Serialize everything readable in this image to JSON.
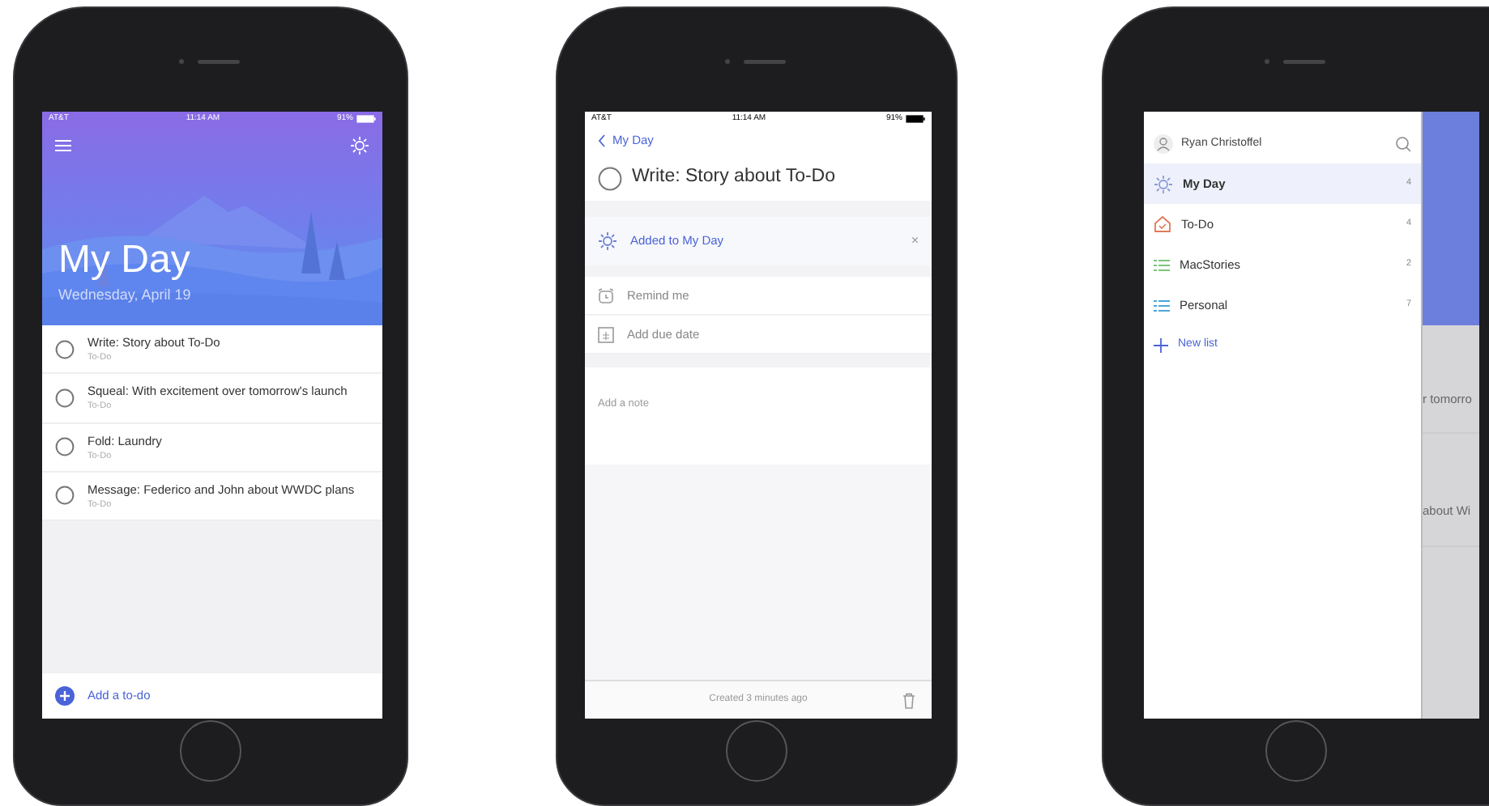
{
  "phones": [
    {
      "kind": "list",
      "status": {
        "carrier": "AT&T",
        "time": "11:14 AM",
        "battery": "91%"
      },
      "title": "My Day",
      "subtitle": "Wednesday, April 19",
      "tasks": [
        {
          "title": "Write: Story about To-Do",
          "list": "To-Do",
          "checked": false
        },
        {
          "title": "Squeal: With excitement over tomorrow's launch",
          "list": "To-Do",
          "checked": false
        },
        {
          "title": "Fold: Laundry",
          "list": "To-Do",
          "checked": false
        },
        {
          "title": "Message: Federico and John about WWDC plans",
          "list": "To-Do",
          "checked": false
        }
      ],
      "add_label": "Add a to-do"
    },
    {
      "kind": "detail",
      "status": {
        "carrier": "AT&T",
        "time": "11:14 AM",
        "battery": "91%"
      },
      "back": "My Day",
      "task": {
        "title": "Write: Story about To-Do",
        "checked": false
      },
      "my_day": "Added to My Day",
      "remove": "×",
      "options": [
        {
          "kind": "reminder",
          "label": "Remind me"
        },
        {
          "kind": "due",
          "label": "Add due date"
        }
      ],
      "note_placeholder": "Add a note",
      "footer": "Created 3 minutes ago"
    },
    {
      "kind": "drawer",
      "user": "Ryan Christoffel",
      "lists": [
        {
          "kind": "myday",
          "name": "My Day",
          "count": "4",
          "selected": true
        },
        {
          "kind": "tasks",
          "name": "To-Do",
          "count": "4",
          "selected": false
        },
        {
          "kind": "list",
          "name": "MacStories",
          "count": "2",
          "selected": false,
          "color": "#7cc47a"
        },
        {
          "kind": "list",
          "name": "Personal",
          "count": "7",
          "selected": false,
          "color": "#4aa6d8"
        }
      ],
      "new_list": "New list",
      "peek": [
        "r tomorro",
        "about Wi"
      ]
    }
  ]
}
